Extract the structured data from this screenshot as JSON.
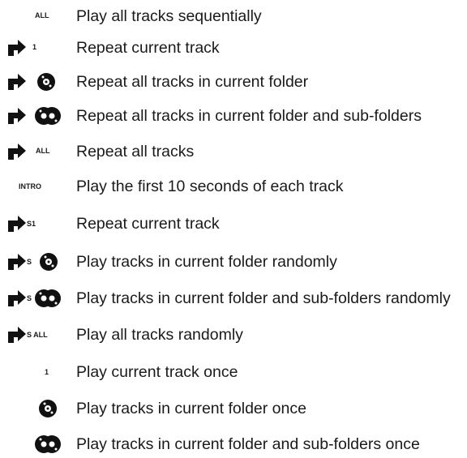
{
  "rows": [
    {
      "icon_text": "ALL",
      "label": "Play all tracks sequentially"
    },
    {
      "icon_text": "1",
      "label": "Repeat current track"
    },
    {
      "icon_text": "",
      "label": "Repeat all tracks in current folder"
    },
    {
      "icon_text": "",
      "label": "Repeat all tracks in current folder and sub-folders"
    },
    {
      "icon_text": "ALL",
      "label": "Repeat all tracks"
    },
    {
      "icon_text": "INTRO",
      "label": "Play the first 10 seconds of each track"
    },
    {
      "icon_text": "S1",
      "label": "Repeat current track"
    },
    {
      "icon_text": "S",
      "label": "Play tracks in current folder randomly"
    },
    {
      "icon_text": "S",
      "label": "Play tracks in current folder and sub-folders randomly"
    },
    {
      "icon_text": "S ALL",
      "label": "Play all tracks randomly"
    },
    {
      "icon_text": "1",
      "label": "Play current track once"
    },
    {
      "icon_text": "",
      "label": "Play tracks in current folder once"
    },
    {
      "icon_text": "",
      "label": "Play tracks in current folder and sub-folders once"
    }
  ]
}
